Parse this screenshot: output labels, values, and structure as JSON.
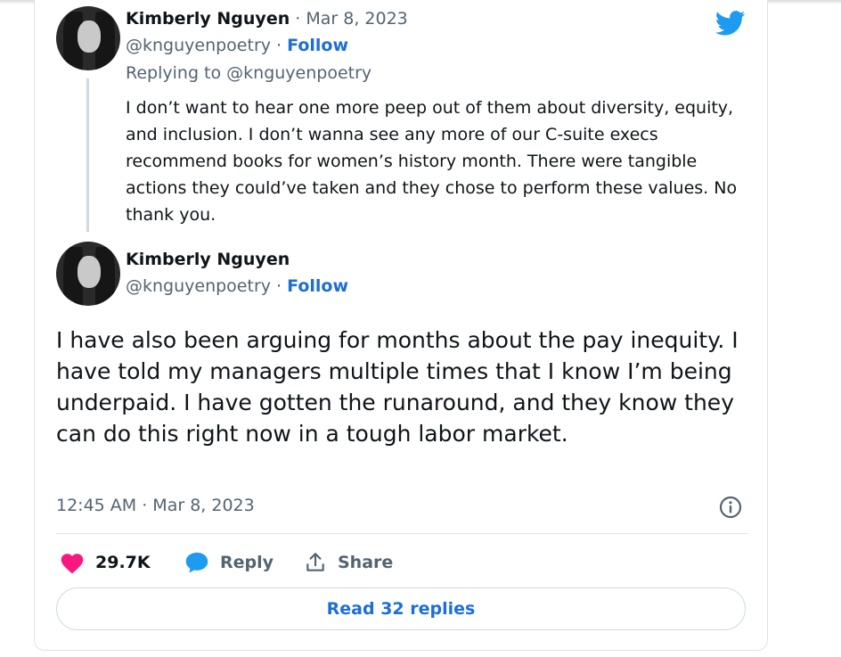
{
  "colors": {
    "accent": "#1d9bf0",
    "like": "#f91880",
    "follow": "#1d6ed6"
  },
  "reply_tweet": {
    "author_name": "Kimberly Nguyen",
    "date": "· Mar 8, 2023",
    "handle": "@knguyenpoetry",
    "handle_sep": " · ",
    "follow_label": "Follow",
    "replying_to": "Replying to @knguyenpoetry",
    "body": "I don’t want to hear one more peep out of them about diversity, equity, and inclusion. I don’t wanna see any more of our C-suite execs recommend books for women’s history month. There were tangible actions they could’ve taken and they chose to perform these values. No thank you."
  },
  "main_tweet": {
    "author_name": "Kimberly Nguyen",
    "handle": "@knguyenpoetry",
    "handle_sep": " · ",
    "follow_label": "Follow",
    "body": "I have also been arguing for months about the pay inequity. I have told my managers multiple times that I know I’m being underpaid. I have gotten the runaround, and they know they can do this right now in a tough labor market.",
    "timestamp": "12:45 AM · Mar 8, 2023"
  },
  "actions": {
    "like_count": "29.7K",
    "reply_label": "Reply",
    "share_label": "Share"
  },
  "read_replies_label": "Read 32 replies",
  "icons": [
    "twitter-bird-icon",
    "heart-icon",
    "reply-bubble-icon",
    "share-icon",
    "info-icon"
  ]
}
